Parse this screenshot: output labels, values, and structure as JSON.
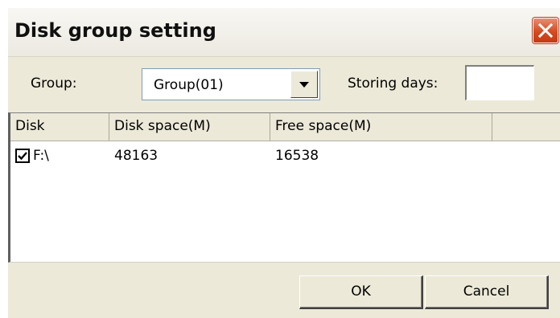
{
  "window": {
    "title": "Disk group setting"
  },
  "toolbar": {
    "group_label": "Group:",
    "group_value": "Group(01)",
    "storing_days_label": "Storing days:",
    "storing_days_value": ""
  },
  "table": {
    "columns": [
      "Disk",
      "Disk space(M)",
      "Free space(M)",
      ""
    ],
    "rows": [
      {
        "checked": true,
        "disk": "F:\\",
        "disk_space": "48163",
        "free_space": "16538"
      }
    ]
  },
  "buttons": {
    "ok": "OK",
    "cancel": "Cancel"
  },
  "colors": {
    "dialog_bg": "#ece9d8",
    "close_button": "#d44b21"
  }
}
